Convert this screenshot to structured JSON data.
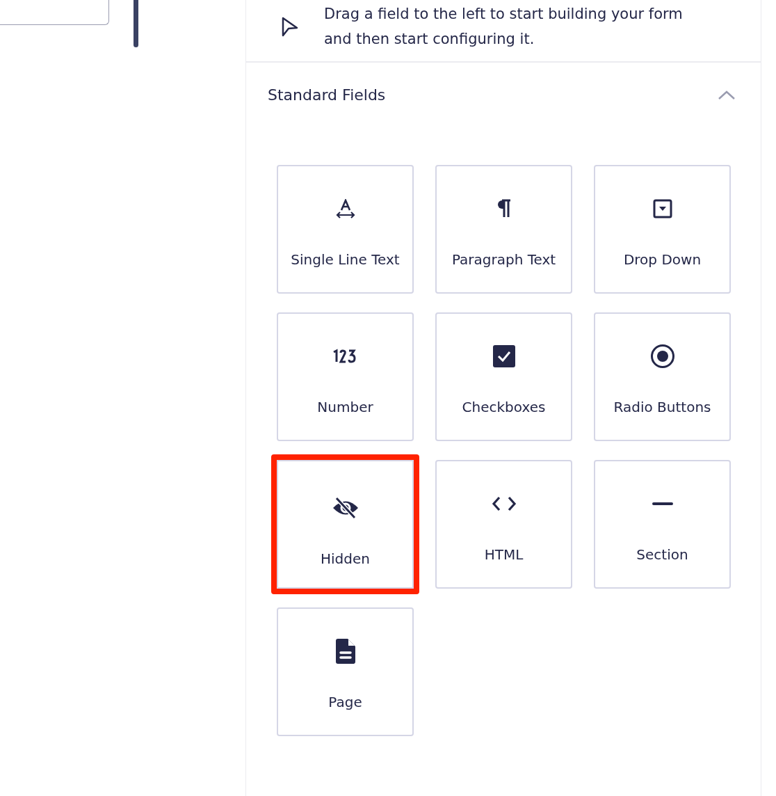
{
  "hint": {
    "text": "Drag a field to the left to start building your form and then start configuring it."
  },
  "section": {
    "title": "Standard Fields",
    "expanded": true
  },
  "fields": [
    {
      "label": "Single Line Text",
      "kind": "text",
      "highlighted": false
    },
    {
      "label": "Paragraph Text",
      "kind": "paragraph",
      "highlighted": false
    },
    {
      "label": "Drop Down",
      "kind": "select",
      "highlighted": false
    },
    {
      "label": "Number",
      "kind": "number",
      "highlighted": false
    },
    {
      "label": "Checkboxes",
      "kind": "checkbox",
      "highlighted": false
    },
    {
      "label": "Radio Buttons",
      "kind": "radio",
      "highlighted": false
    },
    {
      "label": "Hidden",
      "kind": "hidden",
      "highlighted": true
    },
    {
      "label": "HTML",
      "kind": "html",
      "highlighted": false
    },
    {
      "label": "Section",
      "kind": "section",
      "highlighted": false
    },
    {
      "label": "Page",
      "kind": "page",
      "highlighted": false
    }
  ]
}
